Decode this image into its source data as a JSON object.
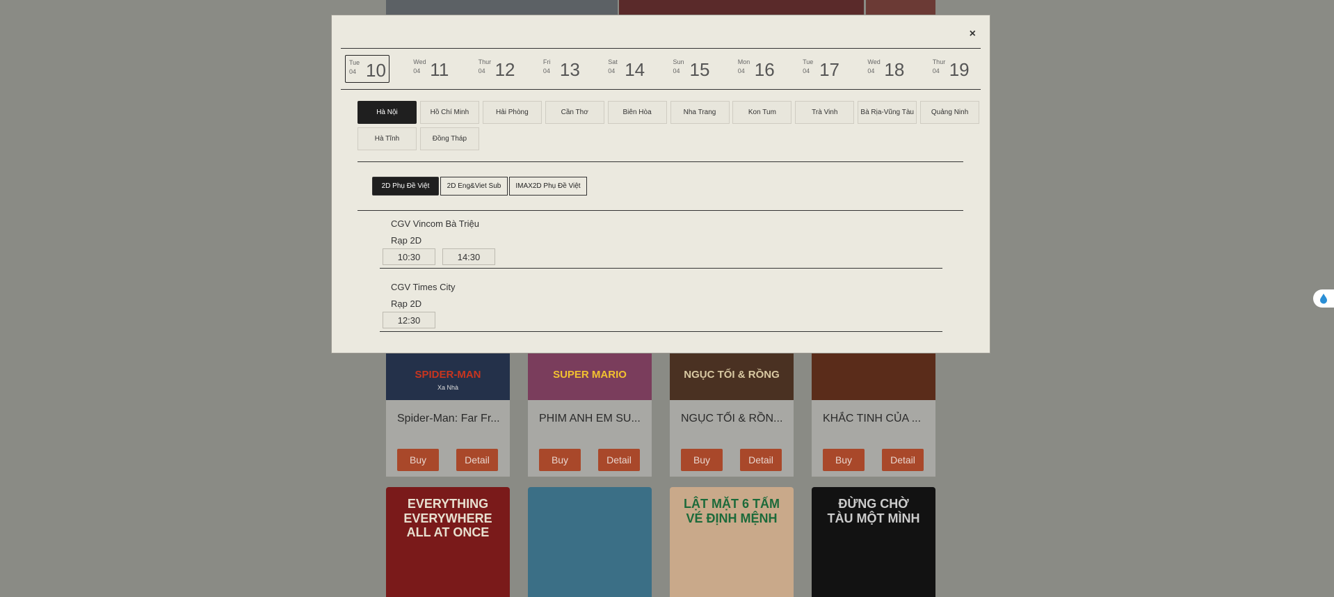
{
  "background": {
    "movies_row1": [
      {
        "title": "Spider-Man: Far Fr...",
        "poster_text": "SPIDER-MAN",
        "poster_sub": "Xa Nhà",
        "poster_bg": "#24314a",
        "poster_fg": "#c9351f"
      },
      {
        "title": "PHIM ANH EM SU...",
        "poster_text": "SUPER MARIO",
        "poster_sub": "",
        "poster_bg": "#7a3d5c",
        "poster_fg": "#f2c230"
      },
      {
        "title": "NGỤC TỐI & RỒN...",
        "poster_text": "NGỤC TỐI & RỒNG",
        "poster_sub": "",
        "poster_bg": "#4a3122",
        "poster_fg": "#d9c9a3"
      },
      {
        "title": "KHẮC TINH CỦA ...",
        "poster_text": "",
        "poster_sub": "",
        "poster_bg": "#5a2c1a",
        "poster_fg": "#d79a4a"
      }
    ],
    "buy_label": "Buy",
    "detail_label": "Detail",
    "movies_row2": [
      {
        "poster_text": "EVERYTHING EVERYWHERE ALL AT ONCE",
        "poster_bg": "#7a1a1a",
        "poster_fg": "#e8e0d0"
      },
      {
        "poster_text": "",
        "poster_bg": "#3b6f86",
        "poster_fg": "#ffffff"
      },
      {
        "poster_text": "LẬT MẶT 6 TẤM VÉ ĐỊNH MỆNH",
        "poster_bg": "#c9a98a",
        "poster_fg": "#1c6a3a"
      },
      {
        "poster_text": "ĐỪNG CHỜ TÀU MỘT MÌNH",
        "poster_bg": "#121212",
        "poster_fg": "#cccccc"
      }
    ]
  },
  "modal": {
    "close_label": "×",
    "dates": [
      {
        "dow": "Tue",
        "month": "04",
        "day": "10",
        "selected": true
      },
      {
        "dow": "Wed",
        "month": "04",
        "day": "11"
      },
      {
        "dow": "Thur",
        "month": "04",
        "day": "12"
      },
      {
        "dow": "Fri",
        "month": "04",
        "day": "13"
      },
      {
        "dow": "Sat",
        "month": "04",
        "day": "14"
      },
      {
        "dow": "Sun",
        "month": "04",
        "day": "15"
      },
      {
        "dow": "Mon",
        "month": "04",
        "day": "16"
      },
      {
        "dow": "Tue",
        "month": "04",
        "day": "17"
      },
      {
        "dow": "Wed",
        "month": "04",
        "day": "18"
      },
      {
        "dow": "Thur",
        "month": "04",
        "day": "19"
      }
    ],
    "cities": [
      "Hà Nội",
      "Hồ Chí Minh",
      "Hải Phòng",
      "Cần Thơ",
      "Biên Hòa",
      "Nha Trang",
      "Kon Tum",
      "Trà Vinh",
      "Bà Rịa-Vũng Tàu",
      "Quảng Ninh",
      "Hà Tĩnh",
      "Đồng Tháp"
    ],
    "selected_city": "Hà Nội",
    "formats": [
      "2D Phụ Đề Việt",
      "2D Eng&Viet Sub",
      "IMAX2D Phụ Đề Việt"
    ],
    "selected_format": "2D Phụ Đề Việt",
    "cinemas": [
      {
        "name": "CGV Vincom Bà Triệu",
        "room": "Rạp 2D",
        "times": [
          "10:30",
          "14:30"
        ]
      },
      {
        "name": "CGV Times City",
        "room": "Rạp 2D",
        "times": [
          "12:30"
        ]
      }
    ]
  },
  "colors": {
    "overlay": "#8a8b85",
    "modal_bg": "#ebe9df",
    "active": "#1f1f1f",
    "buy_button": "#a9482a",
    "fab_icon": "#2b8fd6"
  },
  "fab_icon": "water-drop-icon"
}
